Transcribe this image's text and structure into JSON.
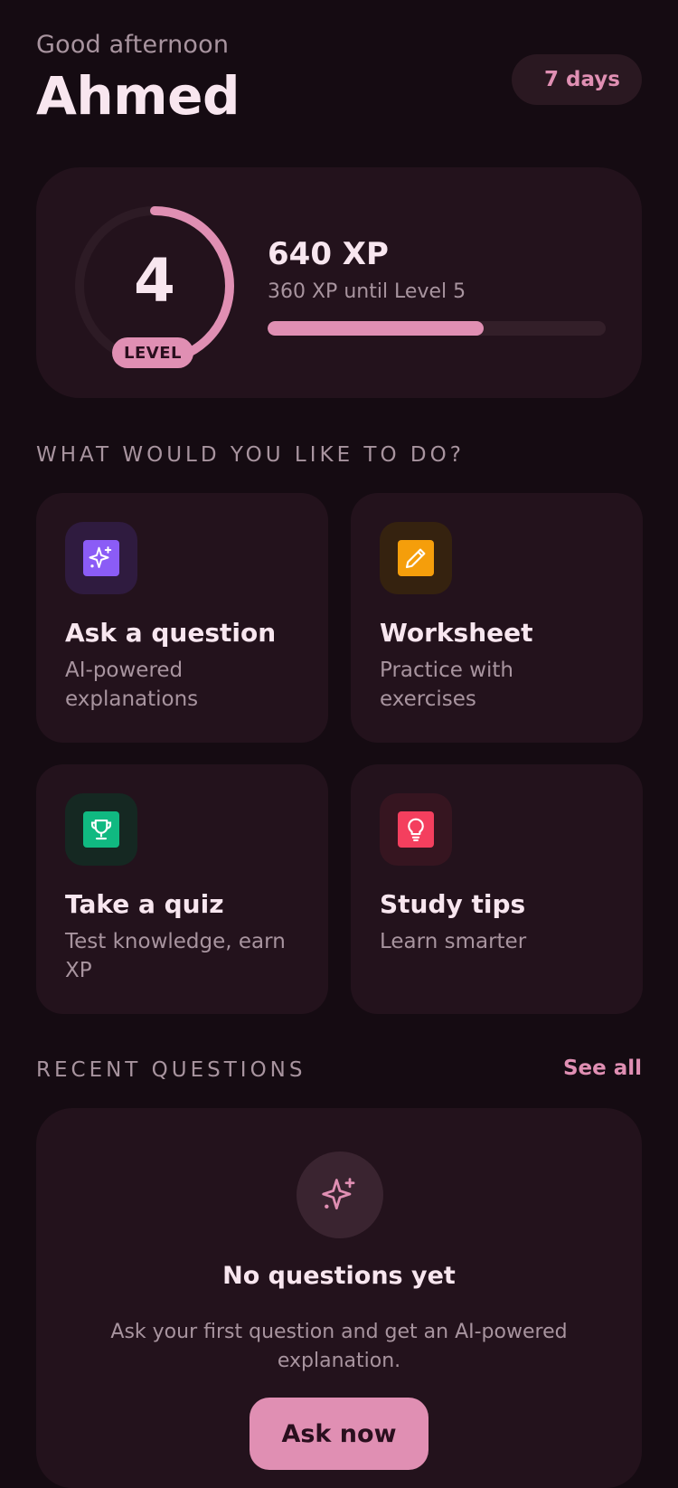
{
  "header": {
    "greeting": "Good afternoon",
    "name": "Ahmed",
    "streak": "7 days"
  },
  "level": {
    "number": "4",
    "badge": "LEVEL",
    "xp": "640 XP",
    "until_next": "360 XP until Level 5",
    "progress_percent": 64
  },
  "actions": {
    "section_title": "WHAT WOULD YOU LIKE TO DO?",
    "items": [
      {
        "title": "Ask a question",
        "subtitle": "AI-powered explanations",
        "icon": "sparkle-icon",
        "color": "#8b5cf6"
      },
      {
        "title": "Worksheet",
        "subtitle": "Practice with exercises",
        "icon": "pencil-icon",
        "color": "#f59e0b"
      },
      {
        "title": "Take a quiz",
        "subtitle": "Test knowledge, earn XP",
        "icon": "trophy-icon",
        "color": "#10b981"
      },
      {
        "title": "Study tips",
        "subtitle": "Learn smarter",
        "icon": "lightbulb-icon",
        "color": "#f43f5e"
      }
    ]
  },
  "recent": {
    "section_title": "RECENT QUESTIONS",
    "see_all": "See all",
    "empty_title": "No questions yet",
    "empty_subtitle": "Ask your first question and get an AI-powered explanation.",
    "cta": "Ask now"
  },
  "colors": {
    "background": "#150b12",
    "card": "#23121c",
    "accent": "#e08fb3"
  }
}
